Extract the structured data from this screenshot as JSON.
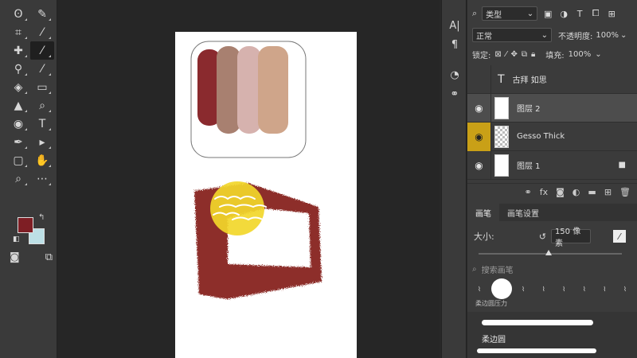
{
  "tools": [
    {
      "name": "lasso-tool",
      "glyph": "ʘ"
    },
    {
      "name": "quick-select-tool",
      "glyph": "✎"
    },
    {
      "name": "crop-tool",
      "glyph": "⌗"
    },
    {
      "name": "eyedropper-tool",
      "glyph": "⁄"
    },
    {
      "name": "spot-heal-tool",
      "glyph": "✚"
    },
    {
      "name": "brush-tool",
      "glyph": "⁄"
    },
    {
      "name": "clone-stamp-tool",
      "glyph": "⚲"
    },
    {
      "name": "history-brush-tool",
      "glyph": "⁄"
    },
    {
      "name": "eraser-tool",
      "glyph": "◈"
    },
    {
      "name": "gradient-tool",
      "glyph": "▭"
    },
    {
      "name": "blur-tool",
      "glyph": "▲"
    },
    {
      "name": "dodge-tool",
      "glyph": "⌕"
    },
    {
      "name": "sponge-tool",
      "glyph": "◉"
    },
    {
      "name": "type-tool",
      "glyph": "T"
    },
    {
      "name": "pen-tool",
      "glyph": "✒"
    },
    {
      "name": "path-select-tool",
      "glyph": "▸"
    },
    {
      "name": "rectangle-tool",
      "glyph": "▢"
    },
    {
      "name": "hand-tool",
      "glyph": "✋"
    },
    {
      "name": "zoom-tool",
      "glyph": "⌕"
    },
    {
      "name": "more-tools",
      "glyph": "⋯"
    }
  ],
  "colors": {
    "foreground": "#7e1e24",
    "background": "#bde0e6"
  },
  "layers_panel": {
    "filter_kind": "类型",
    "blend_mode": "正常",
    "opacity_label": "不透明度:",
    "opacity_value": "100%",
    "lock_label": "锁定:",
    "fill_label": "填充:",
    "fill_value": "100%",
    "layers": [
      {
        "name": "古拜 如思",
        "type": "text",
        "thumb_glyph": "T"
      },
      {
        "name": "图层 2",
        "type": "pixel"
      },
      {
        "name": "Gesso Thick",
        "type": "pixel"
      },
      {
        "name": "图层 1",
        "type": "pixel",
        "locked": true
      }
    ]
  },
  "brush_panel": {
    "tabs": [
      "画笔",
      "画笔设置"
    ],
    "size_label": "大小:",
    "size_value": "150 像素",
    "search_placeholder": "搜索画笔",
    "preset_label": "柔边圆压力",
    "brush_name": "柔边圆"
  },
  "palette_colors": [
    "#8a2a2e",
    "#a88070",
    "#d6b2ae",
    "#cfa58a"
  ],
  "paint_colors": {
    "frame": "#8d2f2a",
    "sun": "#f2d72a"
  }
}
